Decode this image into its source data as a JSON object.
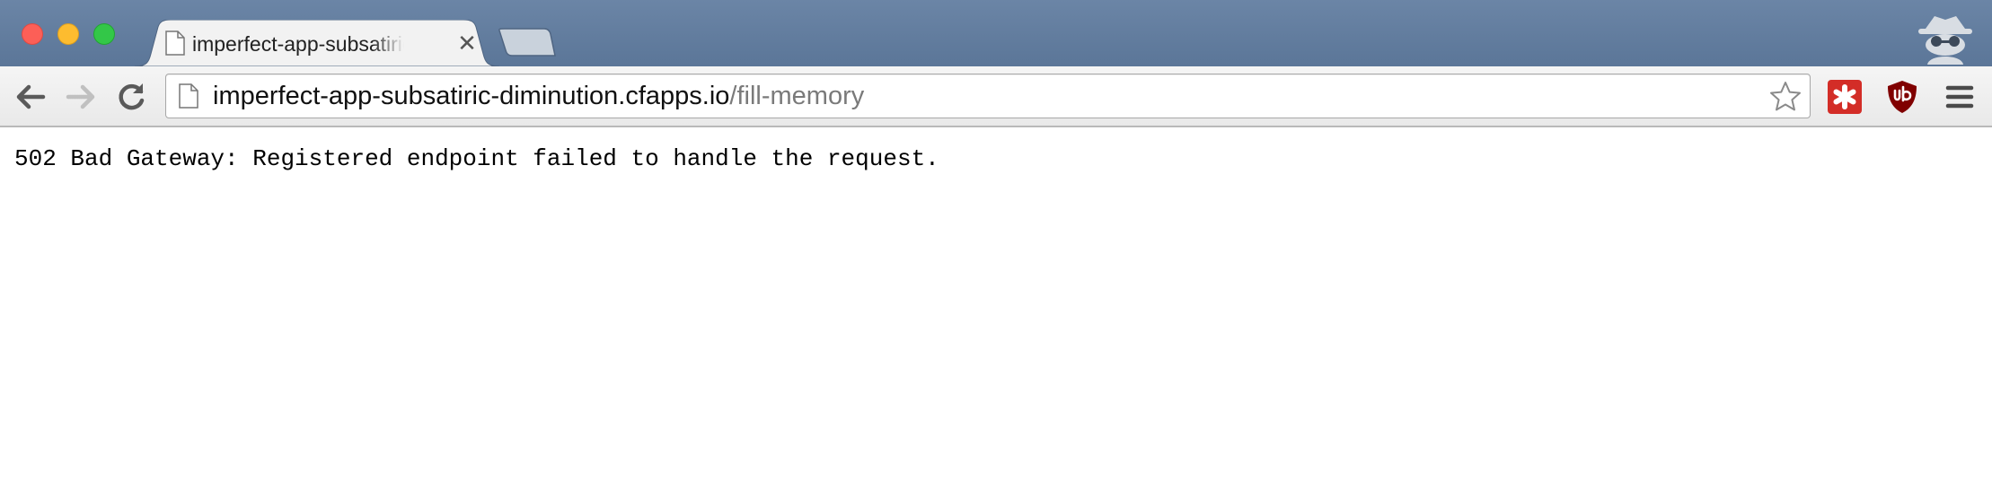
{
  "window": {
    "controls": [
      "close",
      "minimize",
      "maximize"
    ]
  },
  "tab": {
    "title": "imperfect-app-subsatiric-diminution.cfapps.io/fill-memory",
    "favicon": "page-icon",
    "close_glyph": "✕"
  },
  "toolbar": {
    "back_icon": "back-arrow-icon",
    "forward_icon": "forward-arrow-icon",
    "reload_icon": "reload-icon",
    "menu_icon": "hamburger-menu-icon"
  },
  "address_bar": {
    "host": "imperfect-app-subsatiric-diminution.cfapps.io",
    "path": "/fill-memory"
  },
  "extensions": [
    {
      "name": "lastpass-icon",
      "color": "#d32d27"
    },
    {
      "name": "ublock-origin-icon",
      "color": "#800000",
      "label": "uo"
    }
  ],
  "page": {
    "message": "502 Bad Gateway: Registered endpoint failed to handle the request."
  },
  "colors": {
    "tabstrip": "#5e7899",
    "toolbar": "#eeeeee",
    "page_bg": "#ffffff"
  }
}
